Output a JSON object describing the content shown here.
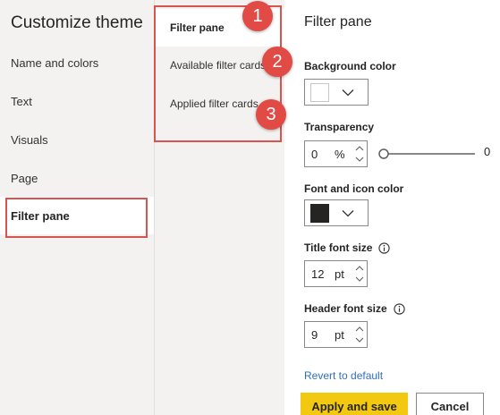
{
  "left_nav": {
    "title": "Customize theme",
    "items": [
      {
        "label": "Name and colors"
      },
      {
        "label": "Text"
      },
      {
        "label": "Visuals"
      },
      {
        "label": "Page"
      },
      {
        "label": "Filter pane",
        "selected": true
      }
    ]
  },
  "sub_nav": {
    "items": [
      {
        "label": "Filter pane",
        "selected": true
      },
      {
        "label": "Available filter cards"
      },
      {
        "label": "Applied filter cards"
      }
    ]
  },
  "callouts": [
    "1",
    "2",
    "3"
  ],
  "panel": {
    "title": "Filter pane",
    "background_color": {
      "label": "Background color",
      "value": "#ffffff"
    },
    "transparency": {
      "label": "Transparency",
      "value": "0",
      "unit": "%",
      "slider_value": "0",
      "slider_fraction": 0
    },
    "font_icon_color": {
      "label": "Font and icon color",
      "value": "#252423"
    },
    "title_font_size": {
      "label": "Title font size",
      "value": "12",
      "unit": "pt"
    },
    "header_font_size": {
      "label": "Header font size",
      "value": "9",
      "unit": "pt"
    },
    "revert_label": "Revert to default",
    "apply_label": "Apply and save",
    "cancel_label": "Cancel"
  },
  "colors": {
    "accent_yellow": "#f2c811",
    "callout_red": "#e14a45",
    "link_blue": "#2f6fbd",
    "nav_background": "#f3f2f1"
  },
  "icons": [
    "chevron-down-icon",
    "info-icon",
    "spin-up-icon",
    "spin-down-icon",
    "slider-thumb"
  ]
}
